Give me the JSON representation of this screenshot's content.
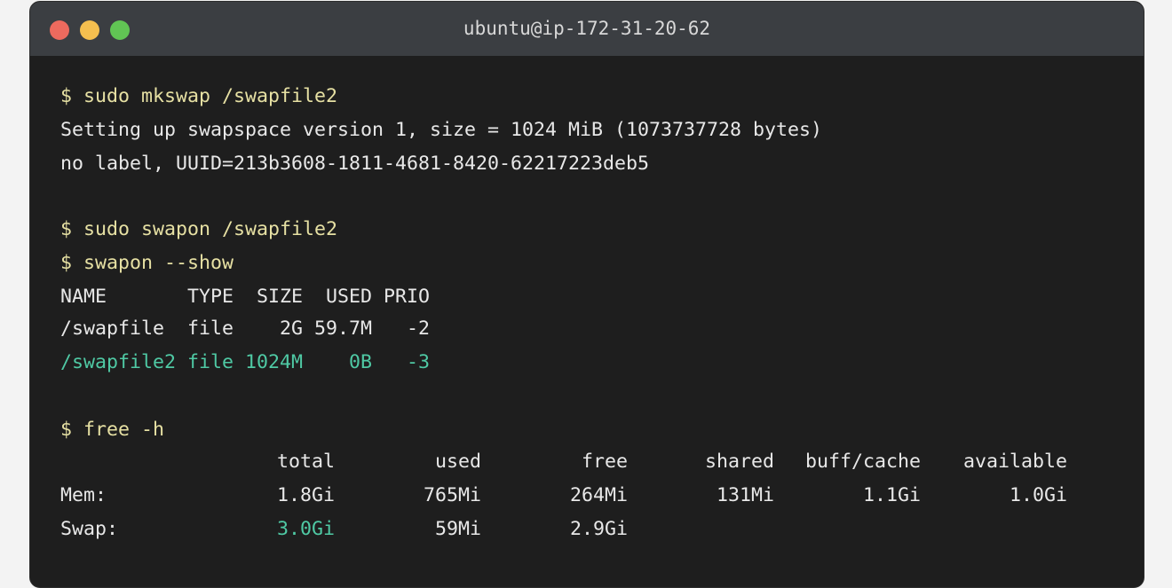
{
  "window": {
    "title": "ubuntu@ip-172-31-20-62",
    "colors": {
      "close": "#ed6a5e",
      "minimize": "#f5bf4f",
      "zoom": "#61c554"
    }
  },
  "colors": {
    "command": "#e6e0a3",
    "output": "#e8e8e8",
    "highlight": "#4fc9a4"
  },
  "terminal": {
    "cmd1": "$ sudo mkswap /swapfile2",
    "out1": "Setting up swapspace version 1, size = 1024 MiB (1073737728 bytes)",
    "out2": "no label, UUID=213b3608-1811-4681-8420-62217223deb5",
    "cmd2": "$ sudo swapon /swapfile2",
    "cmd3": "$ swapon --show",
    "swap_header": "NAME       TYPE  SIZE  USED PRIO",
    "swap_row1": "/swapfile  file    2G 59.7M   -2",
    "swap_row2": "/swapfile2 file 1024M    0B   -3",
    "cmd4": "$ free -h",
    "free": {
      "headers": [
        "total",
        "used",
        "free",
        "shared",
        "buff/cache",
        "available"
      ],
      "mem": {
        "label": "Mem:",
        "values": [
          "1.8Gi",
          "765Mi",
          "264Mi",
          "131Mi",
          "1.1Gi",
          "1.0Gi"
        ]
      },
      "swap": {
        "label": "Swap:",
        "values": [
          "3.0Gi",
          "59Mi",
          "2.9Gi"
        ]
      }
    }
  }
}
